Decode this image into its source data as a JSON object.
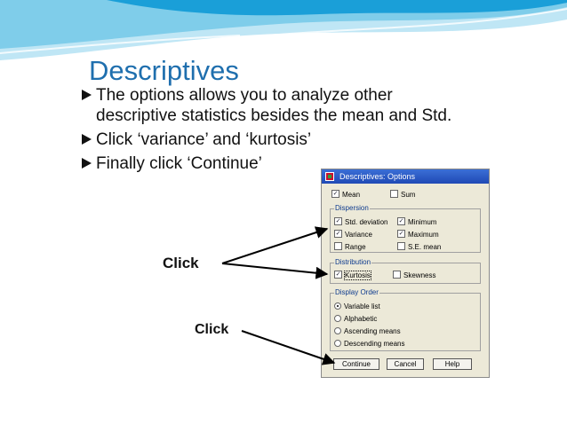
{
  "slide": {
    "title": "Descriptives",
    "bullets": [
      {
        "line1": "The options allows you to analyze other",
        "line2": "descriptive statistics besides the mean and Std."
      },
      {
        "line1": "Click ‘variance’ and ‘kurtosis’"
      },
      {
        "line1": "Finally click ‘Continue’"
      }
    ],
    "callouts": [
      "Click",
      "Click"
    ]
  },
  "dialog": {
    "title": "Descriptives: Options",
    "top_options": [
      {
        "label": "Mean",
        "checked": true
      },
      {
        "label": "Sum",
        "checked": false
      }
    ],
    "dispersion": {
      "label": "Dispersion",
      "items": [
        {
          "label": "Std. deviation",
          "checked": true
        },
        {
          "label": "Minimum",
          "checked": true
        },
        {
          "label": "Variance",
          "checked": true
        },
        {
          "label": "Maximum",
          "checked": true
        },
        {
          "label": "Range",
          "checked": false
        },
        {
          "label": "S.E. mean",
          "checked": false
        }
      ]
    },
    "distribution": {
      "label": "Distribution",
      "items": [
        {
          "label": "Kurtosis",
          "checked": true
        },
        {
          "label": "Skewness",
          "checked": false
        }
      ]
    },
    "display_order": {
      "label": "Display Order",
      "options": [
        {
          "label": "Variable list",
          "selected": true
        },
        {
          "label": "Alphabetic",
          "selected": false
        },
        {
          "label": "Ascending means",
          "selected": false
        },
        {
          "label": "Descending means",
          "selected": false
        }
      ]
    },
    "buttons": {
      "continue": "Continue",
      "cancel": "Cancel",
      "help": "Help"
    }
  },
  "colors": {
    "title": "#1f6fae",
    "banner_dark": "#1a9fd8",
    "banner_light": "#bfe6f5"
  },
  "icons": {
    "bullet": "triangle-bullet",
    "check": "checkmark"
  }
}
